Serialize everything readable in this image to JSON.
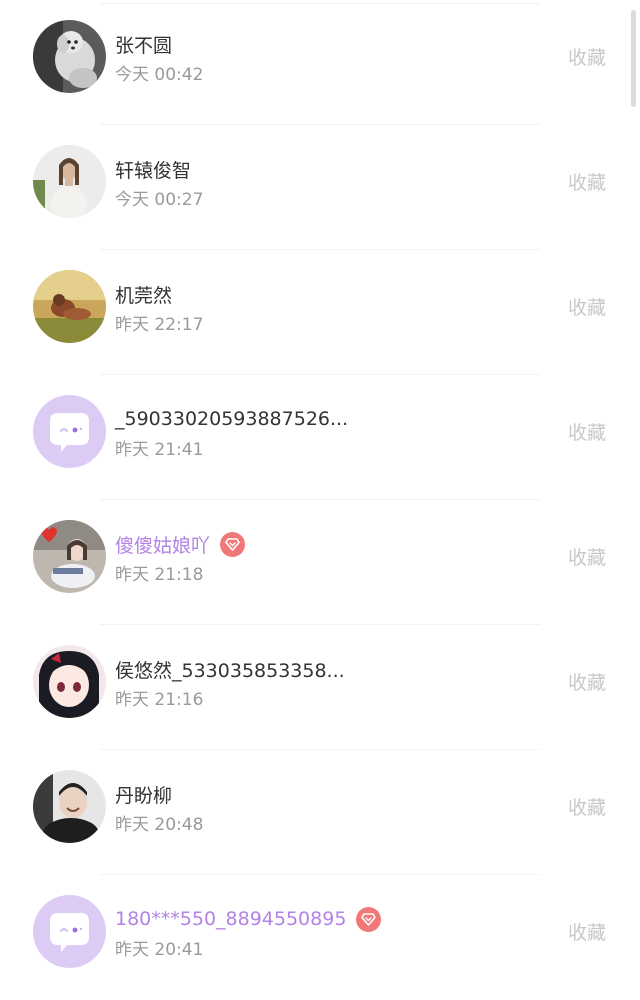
{
  "colors": {
    "vip_name": "#b283e4",
    "vip_badge": "#f07878",
    "favorite_text": "#c8c8c8",
    "time_text": "#9a9a9a"
  },
  "items": [
    {
      "name": "张不圆",
      "time": "今天 00:42",
      "action": "收藏",
      "vip": false,
      "avatar": "photo-dog"
    },
    {
      "name": "轩辕俊智",
      "time": "今天 00:27",
      "action": "收藏",
      "vip": false,
      "avatar": "photo-woman"
    },
    {
      "name": "机莞然",
      "time": "昨天 22:17",
      "action": "收藏",
      "vip": false,
      "avatar": "photo-field"
    },
    {
      "name": "_59033020593887526...",
      "time": "昨天 21:41",
      "action": "收藏",
      "vip": false,
      "avatar": "default-chat-icon"
    },
    {
      "name": "傻傻姑娘吖",
      "time": "昨天 21:18",
      "action": "收藏",
      "vip": true,
      "avatar": "photo-girl"
    },
    {
      "name": "侯悠然_533035853358...",
      "time": "昨天 21:16",
      "action": "收藏",
      "vip": false,
      "avatar": "photo-anime"
    },
    {
      "name": "丹盼柳",
      "time": "昨天 20:48",
      "action": "收藏",
      "vip": false,
      "avatar": "photo-person"
    },
    {
      "name": "180***550_8894550895",
      "time": "昨天 20:41",
      "action": "收藏",
      "vip": true,
      "avatar": "default-chat-icon"
    }
  ]
}
